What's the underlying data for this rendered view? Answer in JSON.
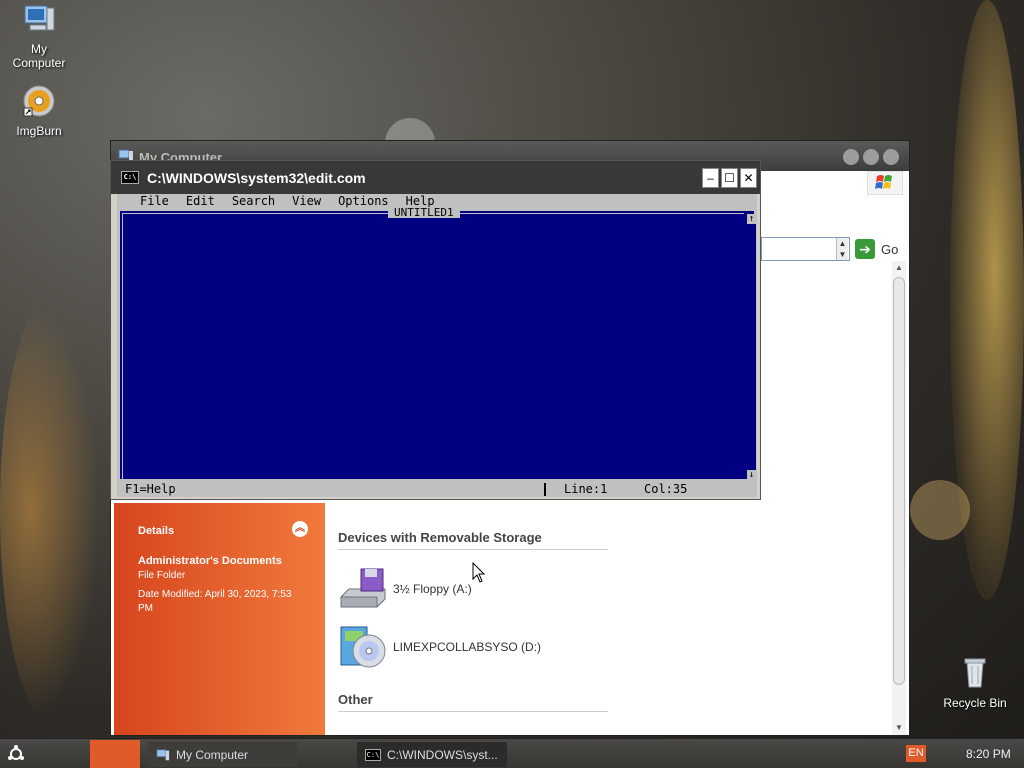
{
  "desktop": {
    "icons": [
      {
        "label": "My Computer",
        "icon": "computer-icon"
      },
      {
        "label": "ImgBurn",
        "icon": "disc-burn-icon"
      },
      {
        "label": "Recycle Bin",
        "icon": "recycle-bin-icon"
      }
    ]
  },
  "explorer": {
    "title": "My Computer",
    "go_label": "Go",
    "details": {
      "heading": "Details",
      "name": "Administrator's Documents",
      "type": "File Folder",
      "modified": "Date Modified: April 30, 2023, 7:53 PM"
    },
    "groups": {
      "removable": "Devices with Removable Storage",
      "other": "Other"
    },
    "drives": [
      {
        "label": "3½ Floppy (A:)",
        "icon": "floppy-drive-icon"
      },
      {
        "label": "LIMEXPCOLLABSYSO (D:)",
        "icon": "cd-drive-icon"
      }
    ]
  },
  "console": {
    "title": "C:\\WINDOWS\\system32\\edit.com",
    "icon_text": "C:\\",
    "menu": [
      "File",
      "Edit",
      "Search",
      "View",
      "Options",
      "Help"
    ],
    "doc_title": "UNTITLED1",
    "status": {
      "help": "F1=Help",
      "line": "Line:1",
      "col": "Col:35"
    }
  },
  "taskbar": {
    "tasks": [
      {
        "label": "My Computer",
        "icon": "computer-icon"
      },
      {
        "label": "C:\\WINDOWS\\syst...",
        "icon": "console-icon"
      }
    ],
    "lang": "EN",
    "clock": "8:20 PM"
  },
  "colors": {
    "editor_bg": "#000080",
    "accent": "#e05a2a"
  }
}
